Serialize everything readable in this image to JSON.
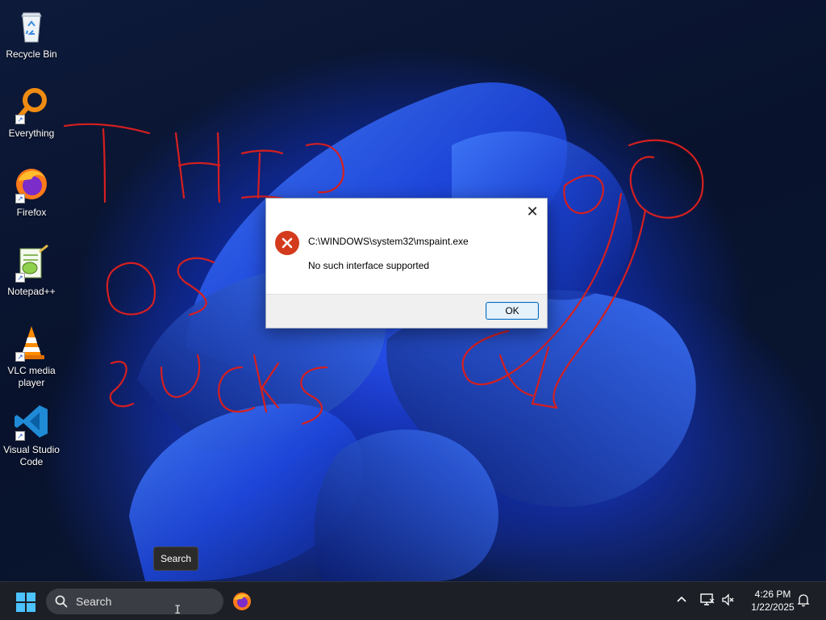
{
  "desktop": {
    "icons": [
      {
        "label": "Recycle Bin",
        "icon": "recycle-bin-icon"
      },
      {
        "label": "Everything",
        "icon": "everything-search-icon"
      },
      {
        "label": "Firefox",
        "icon": "firefox-icon"
      },
      {
        "label": "Notepad++",
        "icon": "notepadpp-icon"
      },
      {
        "label": "VLC media player",
        "icon": "vlc-cone-icon"
      },
      {
        "label": "Visual Studio Code",
        "icon": "vscode-icon"
      }
    ],
    "scribble_color": "#d61f1f"
  },
  "dialog": {
    "path": "C:\\WINDOWS\\system32\\mspaint.exe",
    "message": "No such interface supported",
    "ok_label": "OK",
    "close_glyph": "✕",
    "icon": "error-icon",
    "error_color": "#d33b1c"
  },
  "tooltip": {
    "text": "Search"
  },
  "taskbar": {
    "search_placeholder": "Search",
    "pinned": [
      "firefox-icon"
    ],
    "tray_chevron": "^",
    "time": "4:26 PM",
    "date": "1/22/2025"
  }
}
